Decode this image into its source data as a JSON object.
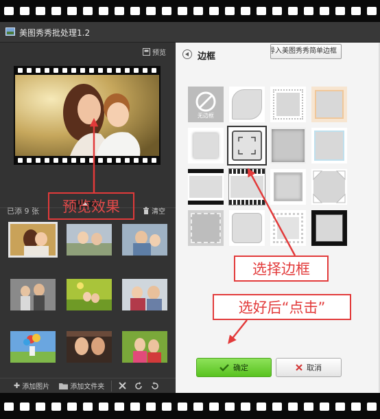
{
  "window": {
    "title": "美图秀秀批处理1.2"
  },
  "left_panel": {
    "preview_label": "预览",
    "added_prefix": "已添",
    "added_count": "9",
    "added_unit": "张",
    "clear_label": "清空",
    "bottom": {
      "add_image": "添加图片",
      "add_folder": "添加文件夹"
    }
  },
  "right_panel": {
    "title": "边框",
    "import_label": "导入美图秀秀简单边框",
    "no_border_label": "无边框",
    "ok_label": "确定",
    "cancel_label": "取消"
  },
  "annotations": {
    "preview_effect": "预览效果",
    "choose_frame": "选择边框",
    "click_after": "选好后“点击”"
  },
  "colors": {
    "accent_green": "#6fd23a",
    "annotation_red": "#e23a3a"
  }
}
